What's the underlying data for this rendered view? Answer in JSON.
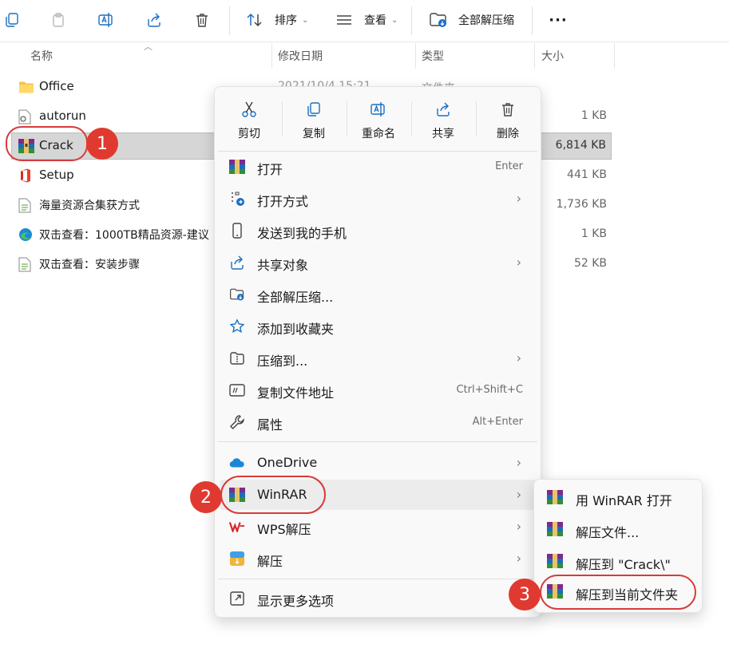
{
  "toolbar": {
    "sort_label": "排序",
    "view_label": "查看",
    "extract_all_label": "全部解压缩",
    "more_label": "···"
  },
  "columns": {
    "name": "名称",
    "date": "修改日期",
    "type": "类型",
    "size": "大小"
  },
  "files": [
    {
      "name": "Office",
      "date": "2021/10/4 15:21",
      "type": "文件夹",
      "size": "",
      "icon": "folder-icon"
    },
    {
      "name": "autorun",
      "date": "",
      "type": "",
      "size": "1 KB",
      "icon": "settings-file-icon"
    },
    {
      "name": "Crack",
      "date": "",
      "type": "",
      "size": "6,814 KB",
      "icon": "winrar-archive-icon"
    },
    {
      "name": "Setup",
      "date": "",
      "type": "",
      "size": "441 KB",
      "icon": "office-icon"
    },
    {
      "name": "海量资源合集获方式",
      "date": "",
      "type": "",
      "size": "1,736 KB",
      "icon": "text-file-icon"
    },
    {
      "name": "双击查看：1000TB精品资源-建议",
      "date": "",
      "type": "",
      "size": "1 KB",
      "icon": "edge-icon"
    },
    {
      "name": "双击查看：安装步骤",
      "date": "",
      "type": "",
      "size": "52 KB",
      "icon": "text-file-icon"
    }
  ],
  "context_menu": {
    "top_actions": [
      "剪切",
      "复制",
      "重命名",
      "共享",
      "删除"
    ],
    "items": [
      {
        "label": "打开",
        "shortcut": "Enter",
        "arrow": "",
        "icon": "winrar-icon"
      },
      {
        "label": "打开方式",
        "shortcut": "",
        "arrow": "›",
        "icon": "open-with-icon"
      },
      {
        "label": "发送到我的手机",
        "shortcut": "",
        "arrow": "",
        "icon": "phone-icon"
      },
      {
        "label": "共享对象",
        "shortcut": "",
        "arrow": "›",
        "icon": "share-icon"
      },
      {
        "label": "全部解压缩...",
        "shortcut": "",
        "arrow": "",
        "icon": "extract-folder-icon"
      },
      {
        "label": "添加到收藏夹",
        "shortcut": "",
        "arrow": "",
        "icon": "star-icon"
      },
      {
        "label": "压缩到...",
        "shortcut": "",
        "arrow": "›",
        "icon": "zip-icon"
      },
      {
        "label": "复制文件地址",
        "shortcut": "Ctrl+Shift+C",
        "arrow": "",
        "icon": "copy-path-icon"
      },
      {
        "label": "属性",
        "shortcut": "Alt+Enter",
        "arrow": "",
        "icon": "wrench-icon"
      },
      {
        "label": "OneDrive",
        "shortcut": "",
        "arrow": "›",
        "icon": "onedrive-icon"
      },
      {
        "label": "WinRAR",
        "shortcut": "",
        "arrow": "›",
        "icon": "winrar-icon"
      },
      {
        "label": "WPS解压",
        "shortcut": "",
        "arrow": "›",
        "icon": "wps-icon"
      },
      {
        "label": "解压",
        "shortcut": "",
        "arrow": "›",
        "icon": "extract-app-icon"
      },
      {
        "label": "显示更多选项",
        "shortcut": "",
        "arrow": "",
        "icon": "more-options-icon"
      }
    ]
  },
  "submenu": {
    "items": [
      "用 WinRAR 打开",
      "解压文件...",
      "解压到 \"Crack\\\"",
      "解压到当前文件夹"
    ]
  },
  "annotations": {
    "step1": "1",
    "step2": "2",
    "step3": "3"
  },
  "colors": {
    "annotation_red": "#e03a30",
    "selection": "#d6d6d6",
    "accent_blue": "#0f6cbd"
  }
}
